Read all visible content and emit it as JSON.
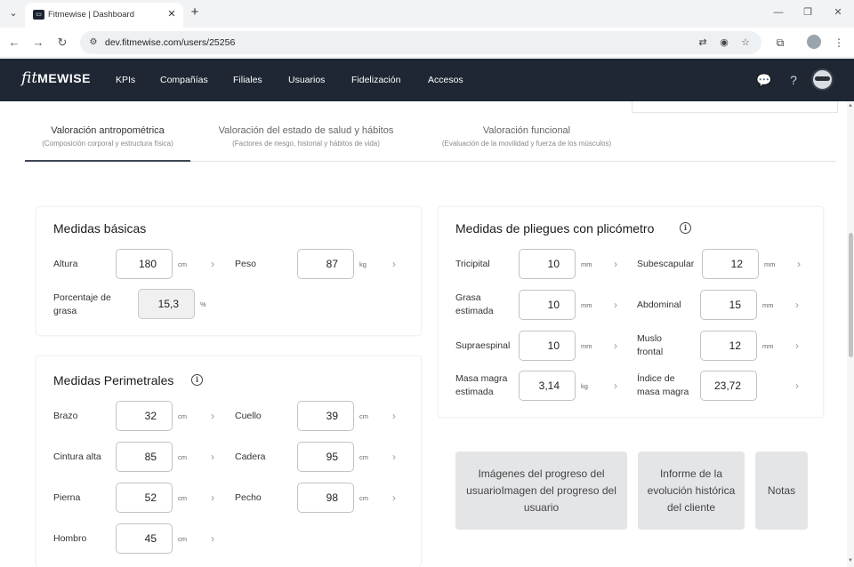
{
  "browser": {
    "tab_title": "Fitmewise | Dashboard",
    "url": "dev.fitmewise.com/users/25256"
  },
  "app": {
    "logo_script": "fit",
    "logo_bold": "MEWISE",
    "nav": [
      "KPIs",
      "Compañías",
      "Filiales",
      "Usuarios",
      "Fidelización",
      "Accesos"
    ]
  },
  "tabs": [
    {
      "title": "Valoración antropométrica",
      "subtitle": "(Composición corporal y estructura física)"
    },
    {
      "title": "Valoración del estado de salud y hábitos",
      "subtitle": "(Factores de riesgo, historial y hábitos de vida)"
    },
    {
      "title": "Valoración funcional",
      "subtitle": "(Evaluación de la movilidad y fuerza de los músculos)"
    }
  ],
  "basicas": {
    "title": "Medidas básicas",
    "altura": {
      "label": "Altura",
      "value": "180",
      "unit": "cm"
    },
    "peso": {
      "label": "Peso",
      "value": "87",
      "unit": "kg"
    },
    "grasa": {
      "label": "Porcentaje de grasa",
      "value": "15,3",
      "unit": "%"
    }
  },
  "perimetrales": {
    "title": "Medidas Perimetrales",
    "brazo": {
      "label": "Brazo",
      "value": "32",
      "unit": "cm"
    },
    "cuello": {
      "label": "Cuello",
      "value": "39",
      "unit": "cm"
    },
    "cintura": {
      "label": "Cintura alta",
      "value": "85",
      "unit": "cm"
    },
    "cadera": {
      "label": "Cadera",
      "value": "95",
      "unit": "cm"
    },
    "pierna": {
      "label": "Pierna",
      "value": "52",
      "unit": "cm"
    },
    "pecho": {
      "label": "Pecho",
      "value": "98",
      "unit": "cm"
    },
    "hombro": {
      "label": "Hombro",
      "value": "45",
      "unit": "cm"
    }
  },
  "pliegues": {
    "title": "Medidas de pliegues con plicómetro",
    "tricipital": {
      "label": "Tricipital",
      "value": "10",
      "unit": "mm"
    },
    "subescapular": {
      "label": "Subescapular",
      "value": "12",
      "unit": "mm"
    },
    "grasa_estimada": {
      "label": "Grasa estimada",
      "value": "10",
      "unit": "mm"
    },
    "abdominal": {
      "label": "Abdominal",
      "value": "15",
      "unit": "mm"
    },
    "supraespinal": {
      "label": "Supraespinal",
      "value": "10",
      "unit": "mm"
    },
    "muslo": {
      "label": "Muslo frontal",
      "value": "12",
      "unit": "mm"
    },
    "masa_magra": {
      "label": "Masa magra estimada",
      "value": "3,14",
      "unit": "kg"
    },
    "indice": {
      "label": "Índice de masa magra",
      "value": "23,72"
    }
  },
  "tiles": {
    "imagenes": "Imágenes del progreso del usuarioImagen del progreso del usuario",
    "informe": "Informe de la evolución histórica del cliente",
    "notas": "Notas"
  },
  "colors": {
    "header_bg": "#1e2733",
    "tile_bg": "#e4e5e7"
  }
}
